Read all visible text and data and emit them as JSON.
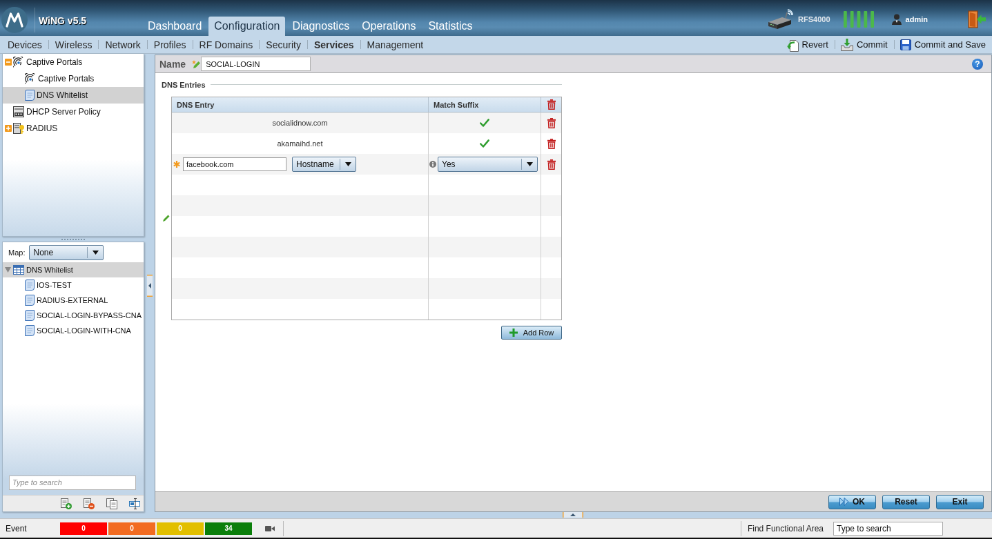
{
  "header": {
    "app_title": "WiNG v5.5",
    "main_tabs": [
      {
        "label": "Dashboard",
        "selected": false
      },
      {
        "label": "Configuration",
        "selected": true
      },
      {
        "label": "Diagnostics",
        "selected": false
      },
      {
        "label": "Operations",
        "selected": false
      },
      {
        "label": "Statistics",
        "selected": false
      }
    ],
    "device_name": "RFS4000",
    "user_name": "admin"
  },
  "sub_nav": {
    "items": [
      {
        "label": "Devices",
        "selected": false
      },
      {
        "label": "Wireless",
        "selected": false
      },
      {
        "label": "Network",
        "selected": false
      },
      {
        "label": "Profiles",
        "selected": false
      },
      {
        "label": "RF Domains",
        "selected": false
      },
      {
        "label": "Security",
        "selected": false
      },
      {
        "label": "Services",
        "selected": true
      },
      {
        "label": "Management",
        "selected": false
      }
    ],
    "actions": [
      {
        "kind": "revert",
        "label": "Revert"
      },
      {
        "kind": "commit",
        "label": "Commit"
      },
      {
        "kind": "save",
        "label": "Commit and Save"
      }
    ]
  },
  "tree_panel": {
    "items": [
      {
        "label": "Captive Portals",
        "kind": "portal",
        "expanded": true,
        "selected": false,
        "children": [
          {
            "label": "Captive Portals",
            "kind": "portal",
            "selected": false
          },
          {
            "label": "DNS Whitelist",
            "kind": "list",
            "selected": true
          }
        ]
      },
      {
        "label": "DHCP Server Policy",
        "kind": "dhcp",
        "selected": false
      },
      {
        "label": "RADIUS",
        "kind": "radius",
        "expanded": false,
        "selected": false
      }
    ]
  },
  "browser_panel": {
    "map_label": "Map:",
    "map_value": "None",
    "items": [
      {
        "label": "DNS Whitelist",
        "kind": "table",
        "expanded": true,
        "selected": true,
        "children": [
          {
            "label": "IOS-TEST",
            "kind": "list",
            "selected": false
          },
          {
            "label": "RADIUS-EXTERNAL",
            "kind": "list",
            "selected": false
          },
          {
            "label": "SOCIAL-LOGIN-BYPASS-CNA",
            "kind": "list",
            "selected": false
          },
          {
            "label": "SOCIAL-LOGIN-WITH-CNA",
            "kind": "list",
            "selected": false
          }
        ]
      }
    ],
    "search_placeholder": "Type to search"
  },
  "editor": {
    "name_label": "Name",
    "name_value": "SOCIAL-LOGIN",
    "help_label": "?",
    "section_title": "DNS Entries",
    "columns": [
      "DNS Entry",
      "Match Suffix"
    ],
    "rows": [
      {
        "kind": "saved",
        "required": false,
        "entry": "socialidnow.com",
        "match_suffix": true
      },
      {
        "kind": "saved",
        "required": false,
        "entry": "akamaihd.net",
        "match_suffix": true
      },
      {
        "kind": "editing",
        "required": true,
        "entry": "facebook.com",
        "entry_type": "Hostname",
        "match_suffix_value": "Yes"
      }
    ],
    "add_row_label": "Add Row"
  },
  "buttons": [
    {
      "kind": "ok",
      "label": "OK"
    },
    {
      "kind": "reset",
      "label": "Reset"
    },
    {
      "kind": "exit",
      "label": "Exit"
    }
  ],
  "status_bar": {
    "event_label": "Event",
    "event_counts": [
      {
        "count": "0",
        "color": "#ff0000"
      },
      {
        "count": "0",
        "color": "#f26b21"
      },
      {
        "count": "0",
        "color": "#e2bf00"
      },
      {
        "count": "34",
        "color": "#0b7f0b"
      }
    ],
    "find_label": "Find Functional Area",
    "find_placeholder": "Type to search"
  }
}
